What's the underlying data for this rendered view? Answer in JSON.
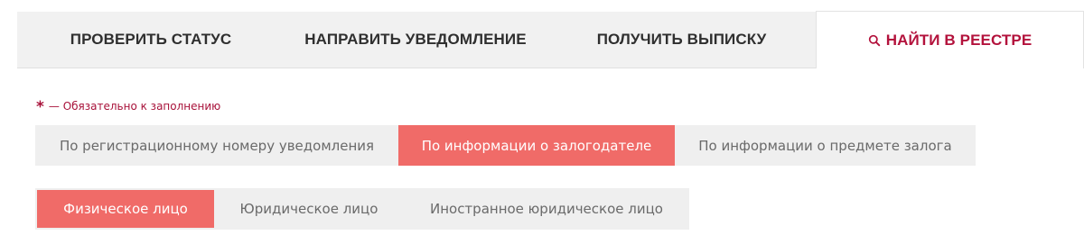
{
  "top_tabs": {
    "check_status": "ПРОВЕРИТЬ СТАТУС",
    "send_notification": "НАПРАВИТЬ УВЕДОМЛЕНИЕ",
    "get_extract": "ПОЛУЧИТЬ ВЫПИСКУ",
    "find_in_registry": "НАЙТИ В РЕЕСТРЕ",
    "active": "find_in_registry",
    "active_color": "#b3123c"
  },
  "required_note": {
    "star": "*",
    "text": "— Обязательно к заполнению"
  },
  "search_type": {
    "options": [
      "По регистрационному номеру уведомления",
      "По информации о залогодателе",
      "По информации о предмете залога"
    ],
    "selected": "По информации о залогодателе",
    "accent_color": "#f06b68"
  },
  "pledgor_type": {
    "options": [
      "Физическое лицо",
      "Юридическое лицо",
      "Иностранное юридическое лицо"
    ],
    "selected": "Физическое лицо"
  }
}
